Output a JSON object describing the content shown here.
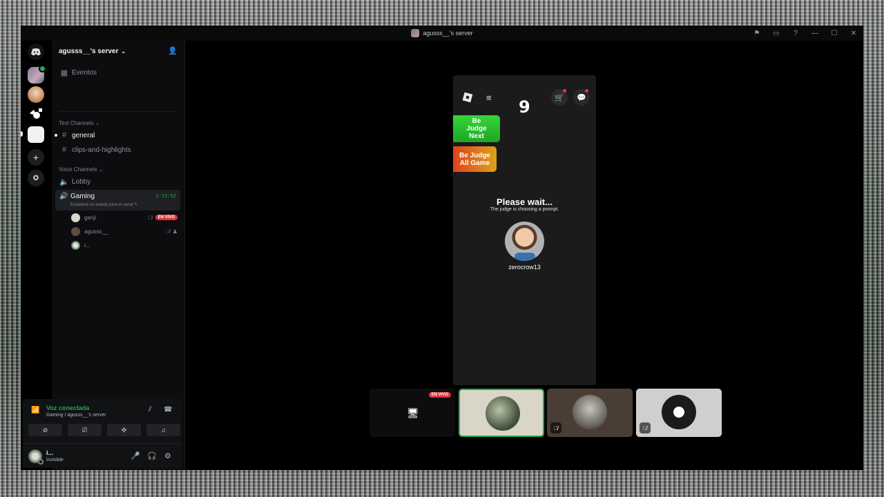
{
  "window": {
    "title": "agusss__'s server"
  },
  "server": {
    "name": "agusss__'s server"
  },
  "sidebar": {
    "events_label": "Eventos",
    "text_category": "Text Channels",
    "text_channels": [
      {
        "name": "general"
      },
      {
        "name": "clips-and-highlights"
      }
    ],
    "voice_category": "Voice Channels",
    "voice_channels": [
      {
        "name": "Lobby"
      },
      {
        "name": "Gaming",
        "status": "Establece un estado para el canal",
        "timer": "2:15:52"
      }
    ],
    "voice_users": [
      {
        "name": "genji",
        "badge": "EN VIVO"
      },
      {
        "name": "agusss__"
      },
      {
        "name": "i..."
      }
    ]
  },
  "voice_panel": {
    "title": "Voz conectada",
    "subtitle": "Gaming / agusss__'s server"
  },
  "user_panel": {
    "name": "i...",
    "status": "invisible"
  },
  "game": {
    "counter": "9",
    "btn_next": "Be Judge Next",
    "btn_all": "Be Judge All Game",
    "wait_title": "Please wait...",
    "wait_sub": "The judge is choosing a prompt.",
    "username": "zerocrow13"
  },
  "tiles": {
    "live_label": "EN VIVO"
  },
  "colors": {
    "connected_green": "#23a55a",
    "live_red": "#da373c",
    "judge_next_green": "#2ec934",
    "judge_all_orange": "#dd7a1c"
  }
}
